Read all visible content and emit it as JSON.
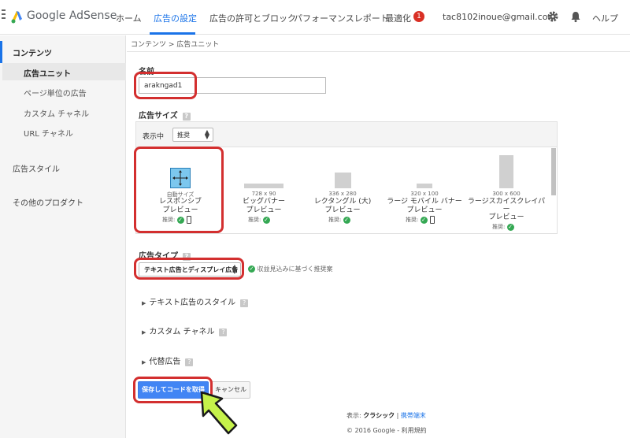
{
  "brand": {
    "name": "Google AdSense"
  },
  "nav": {
    "items": [
      {
        "label": "ホーム",
        "active": false
      },
      {
        "label": "広告の設定",
        "active": true
      },
      {
        "label": "広告の許可とブロック",
        "active": false
      },
      {
        "label": "パフォーマンスレポート",
        "active": false
      },
      {
        "label": "最適化",
        "active": false
      }
    ],
    "badge_count": "1",
    "email": "tac8102inoue@gmail.com",
    "help_label": "ヘルプ"
  },
  "sidebar": {
    "content_label": "コンテンツ",
    "items": [
      {
        "label": "広告ユニット",
        "selected": true
      },
      {
        "label": "ページ単位の広告",
        "selected": false
      },
      {
        "label": "カスタム チャネル",
        "selected": false
      },
      {
        "label": "URL チャネル",
        "selected": false
      }
    ],
    "ad_style_label": "広告スタイル",
    "other_products_label": "その他のプロダクト"
  },
  "breadcrumb": "コンテンツ > 広告ユニット",
  "form": {
    "name_label": "名前",
    "name_value": "arakngad1",
    "size_label": "広告サイズ",
    "show_label": "表示中",
    "show_select": "推奨",
    "sizes": [
      {
        "dim": "自動サイズ",
        "name": [
          "レスポンシブ",
          "プレビュー"
        ],
        "rec": "推奨:"
      },
      {
        "dim": "728 x 90",
        "name": [
          "ビッグバナー",
          "プレビュー"
        ],
        "rec": "推奨:"
      },
      {
        "dim": "336 x 280",
        "name": [
          "レクタングル (大)",
          "プレビュー"
        ],
        "rec": "推奨:"
      },
      {
        "dim": "320 x 100",
        "name": [
          "ラージ モバイル バナー",
          "プレビュー"
        ],
        "rec": "推奨:"
      },
      {
        "dim": "300 x 600",
        "name": [
          "ラージスカイスクレイパ",
          "ー",
          "プレビュー"
        ],
        "rec": "推奨:"
      }
    ],
    "type_label": "広告タイプ",
    "type_value": "テキスト広告とディスプレイ広告",
    "type_hint": "収益見込みに基づく推奨案",
    "text_ad_style": "テキスト広告のスタイル",
    "custom_channel": "カスタム チャネル",
    "backup_ads": "代替広告",
    "save_label": "保存してコードを取得",
    "cancel_label": "キャンセル"
  },
  "footer": {
    "display_label": "表示:",
    "classic": "クラシック",
    "mobile": "携帯端末",
    "copyright": "© 2016 Google -",
    "terms": "利用規約"
  },
  "colors": {
    "accent": "#1a73e8",
    "highlight": "#d32f2f",
    "arrow": "#c6f24a",
    "save": "#4285f4"
  },
  "icons": [
    "adsense-logo-icon",
    "menu-icon",
    "gear-icon",
    "bell-icon",
    "help-icon",
    "check-icon",
    "phone-icon",
    "responsive-icon",
    "chevron-right-icon"
  ]
}
